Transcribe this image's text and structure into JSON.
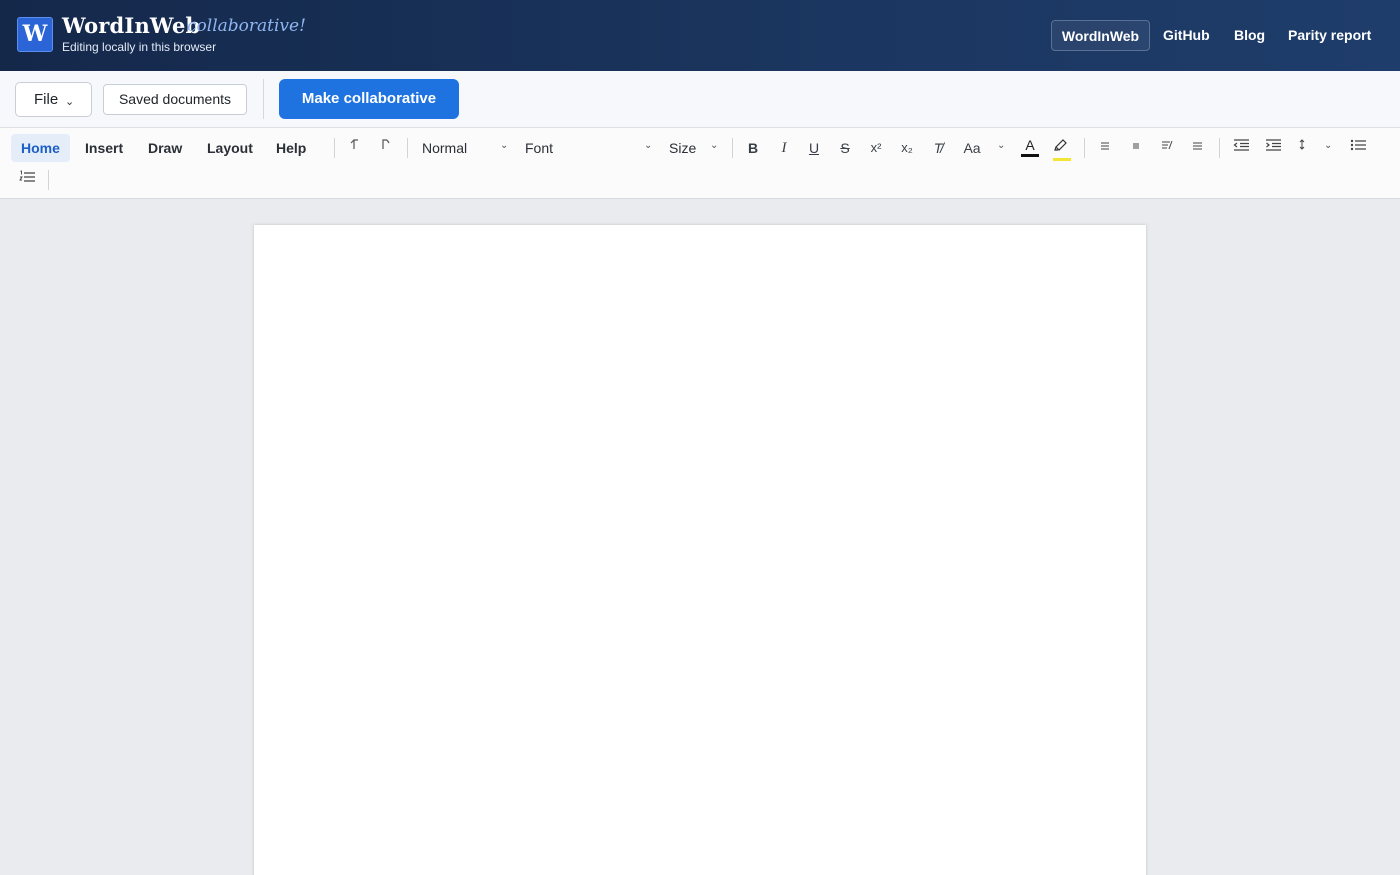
{
  "header": {
    "brand": "WordInWeb",
    "brand_tag": "collaborative!",
    "logo_letter": "W",
    "subtitle": "Editing locally in this browser",
    "nav": [
      "WordInWeb",
      "GitHub",
      "Blog",
      "Parity report"
    ]
  },
  "actions": {
    "file": "File",
    "saved": "Saved documents",
    "collab": "Make collaborative"
  },
  "ribbon": {
    "tabs": [
      "Home",
      "Insert",
      "Draw",
      "Layout",
      "Help"
    ],
    "active_tab": "Home",
    "style": "Normal",
    "font": "Font",
    "size": "Size",
    "buttons": {
      "bold": "B",
      "italic": "I",
      "underline": "U",
      "strike": "S",
      "superscript": "x²",
      "subscript": "x₂",
      "clear": "T̸",
      "case": "Aa",
      "font_color": "A"
    }
  },
  "colors": {
    "header_bg": "#1b3660",
    "accent": "#1f73e0",
    "font_color_bar": "#111111",
    "highlight_bar": "#f2e534"
  }
}
